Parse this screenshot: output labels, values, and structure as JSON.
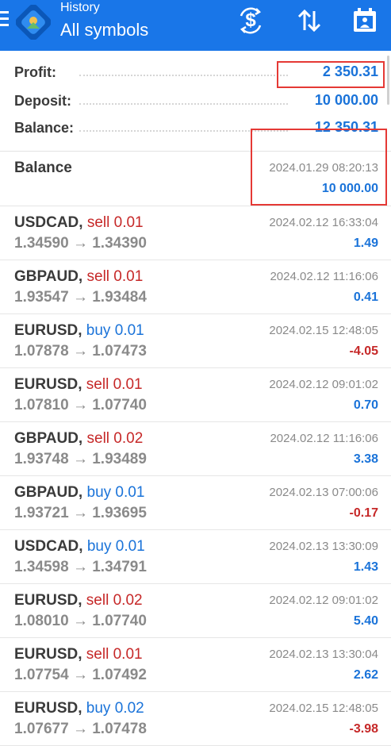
{
  "header": {
    "subtitle": "History",
    "title": "All symbols",
    "icons": [
      "menu-icon",
      "app-logo",
      "currency-filter-icon",
      "sort-icon",
      "calendar-icon"
    ]
  },
  "summary": {
    "profit_label": "Profit:",
    "profit_value": "2 350.31",
    "deposit_label": "Deposit:",
    "deposit_value": "10 000.00",
    "balance_label": "Balance:",
    "balance_value": "12 350.31"
  },
  "balance_entry": {
    "label": "Balance",
    "time": "2024.01.29 08:20:13",
    "amount": "10 000.00"
  },
  "trades": [
    {
      "symbol": "USDCAD,",
      "side": "sell",
      "volume": "0.01",
      "prices": "1.34590 → 1.34390",
      "time": "2024.02.12 16:33:04",
      "profit": "1.49"
    },
    {
      "symbol": "GBPAUD,",
      "side": "sell",
      "volume": "0.01",
      "prices": "1.93547 → 1.93484",
      "time": "2024.02.12 11:16:06",
      "profit": "0.41"
    },
    {
      "symbol": "EURUSD,",
      "side": "buy",
      "volume": "0.01",
      "prices": "1.07878 → 1.07473",
      "time": "2024.02.15 12:48:05",
      "profit": "-4.05"
    },
    {
      "symbol": "EURUSD,",
      "side": "sell",
      "volume": "0.01",
      "prices": "1.07810 → 1.07740",
      "time": "2024.02.12 09:01:02",
      "profit": "0.70"
    },
    {
      "symbol": "GBPAUD,",
      "side": "sell",
      "volume": "0.02",
      "prices": "1.93748 → 1.93489",
      "time": "2024.02.12 11:16:06",
      "profit": "3.38"
    },
    {
      "symbol": "GBPAUD,",
      "side": "buy",
      "volume": "0.01",
      "prices": "1.93721 → 1.93695",
      "time": "2024.02.13 07:00:06",
      "profit": "-0.17"
    },
    {
      "symbol": "USDCAD,",
      "side": "buy",
      "volume": "0.01",
      "prices": "1.34598 → 1.34791",
      "time": "2024.02.13 13:30:09",
      "profit": "1.43"
    },
    {
      "symbol": "EURUSD,",
      "side": "sell",
      "volume": "0.02",
      "prices": "1.08010 → 1.07740",
      "time": "2024.02.12 09:01:02",
      "profit": "5.40"
    },
    {
      "symbol": "EURUSD,",
      "side": "sell",
      "volume": "0.01",
      "prices": "1.07754 → 1.07492",
      "time": "2024.02.13 13:30:04",
      "profit": "2.62"
    },
    {
      "symbol": "EURUSD,",
      "side": "buy",
      "volume": "0.02",
      "prices": "1.07677 → 1.07478",
      "time": "2024.02.15 12:48:05",
      "profit": "-3.98"
    }
  ],
  "colors": {
    "appbar": "#1976e8",
    "positive": "#1a73d9",
    "negative": "#c62828",
    "highlight_box": "#e53935"
  }
}
